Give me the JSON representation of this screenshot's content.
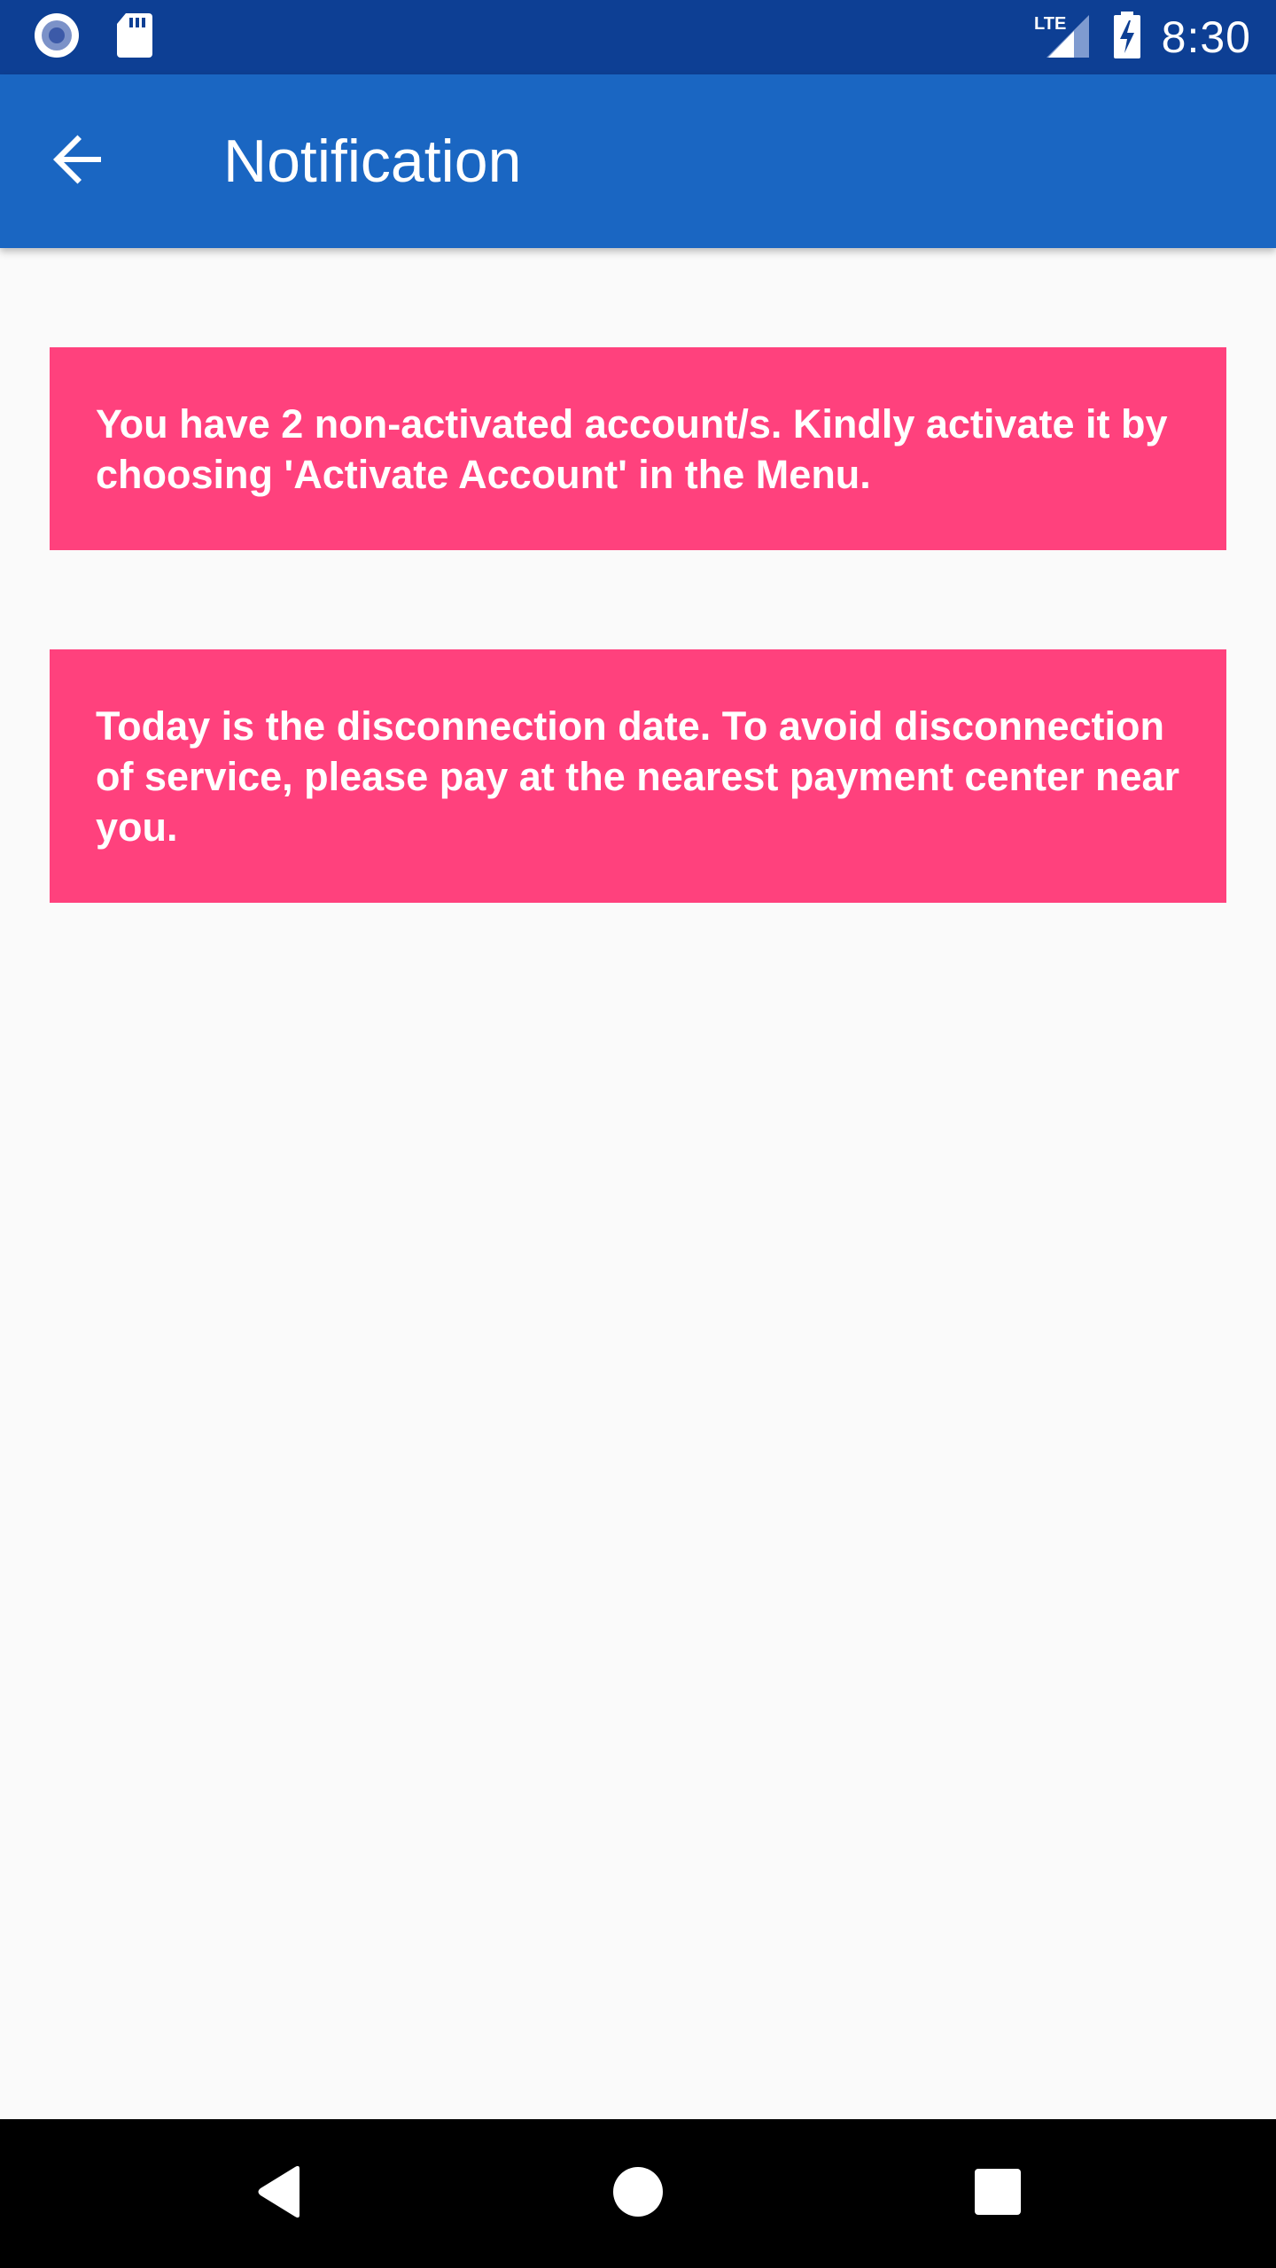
{
  "status_bar": {
    "time": "8:30",
    "network_label": "LTE",
    "icons": [
      "record-icon",
      "sd-card-icon",
      "lte-signal-icon",
      "battery-charging-icon"
    ]
  },
  "app_bar": {
    "title": "Notification",
    "back_icon": "arrow-back-icon"
  },
  "notifications": [
    {
      "text": "You have 2 non-activated account/s. Kindly activate it by choosing 'Activate Account' in the Menu."
    },
    {
      "text": "Today is the disconnection date. To avoid disconnection of service, please pay at the nearest payment center near you."
    }
  ],
  "nav_bar": {
    "icons": [
      "nav-back-icon",
      "nav-home-icon",
      "nav-recents-icon"
    ]
  },
  "colors": {
    "status_bar": "#0d3f94",
    "app_bar": "#1a66c2",
    "card": "#ff417d",
    "background": "#fafafa",
    "nav_bar": "#000000"
  }
}
